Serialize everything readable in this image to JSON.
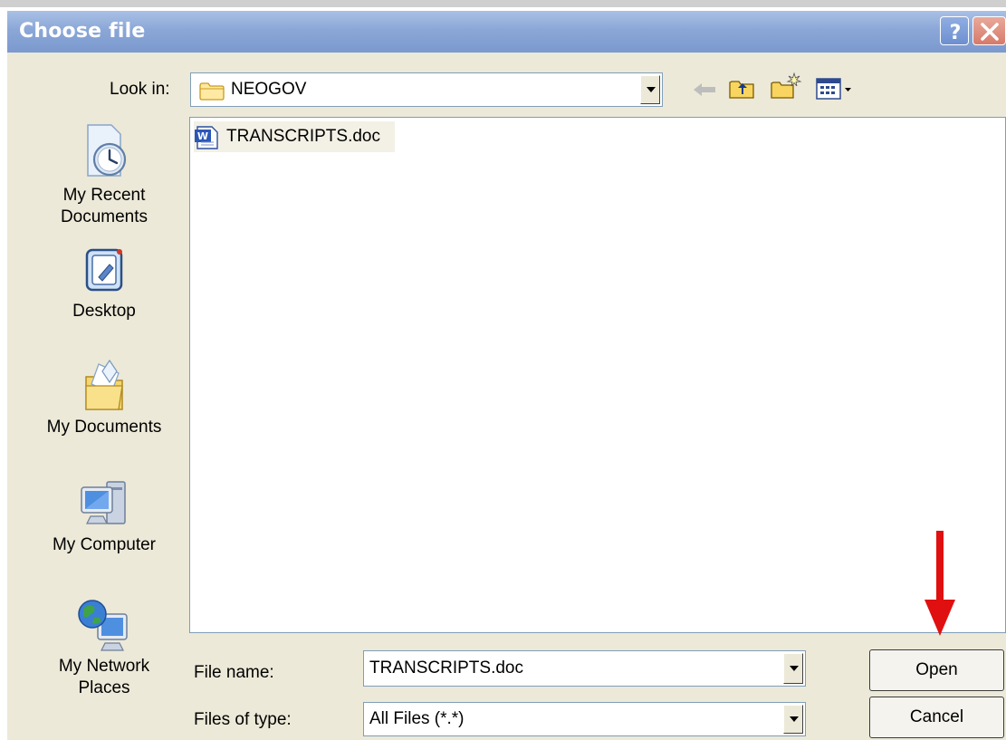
{
  "dialog": {
    "title": "Choose file",
    "help_button": "?",
    "close_button": "✕"
  },
  "toolbar": {
    "look_in_label": "Look in:",
    "look_in_value": "NEOGOV",
    "icons": [
      "back-icon",
      "up-folder-icon",
      "new-folder-icon",
      "view-menu-icon"
    ]
  },
  "places": [
    {
      "label_1": "My Recent",
      "label_2": "Documents",
      "icon": "recent-documents-icon"
    },
    {
      "label_1": "Desktop",
      "icon": "desktop-icon"
    },
    {
      "label_1": "My Documents",
      "icon": "my-documents-icon"
    },
    {
      "label_1": "My Computer",
      "icon": "my-computer-icon"
    },
    {
      "label_1": "My Network",
      "label_2": "Places",
      "icon": "network-places-icon"
    }
  ],
  "files": [
    {
      "name": "TRANSCRIPTS.doc",
      "icon": "word-document-icon"
    }
  ],
  "filename": {
    "label": "File name:",
    "value": "TRANSCRIPTS.doc"
  },
  "filetype": {
    "label": "Files of type:",
    "value": "All Files (*.*)"
  },
  "buttons": {
    "open": "Open",
    "cancel": "Cancel"
  },
  "colors": {
    "titlebar": "#8ba7d7",
    "dialog_bg": "#ece9d8",
    "annotation_arrow": "#e01010"
  }
}
